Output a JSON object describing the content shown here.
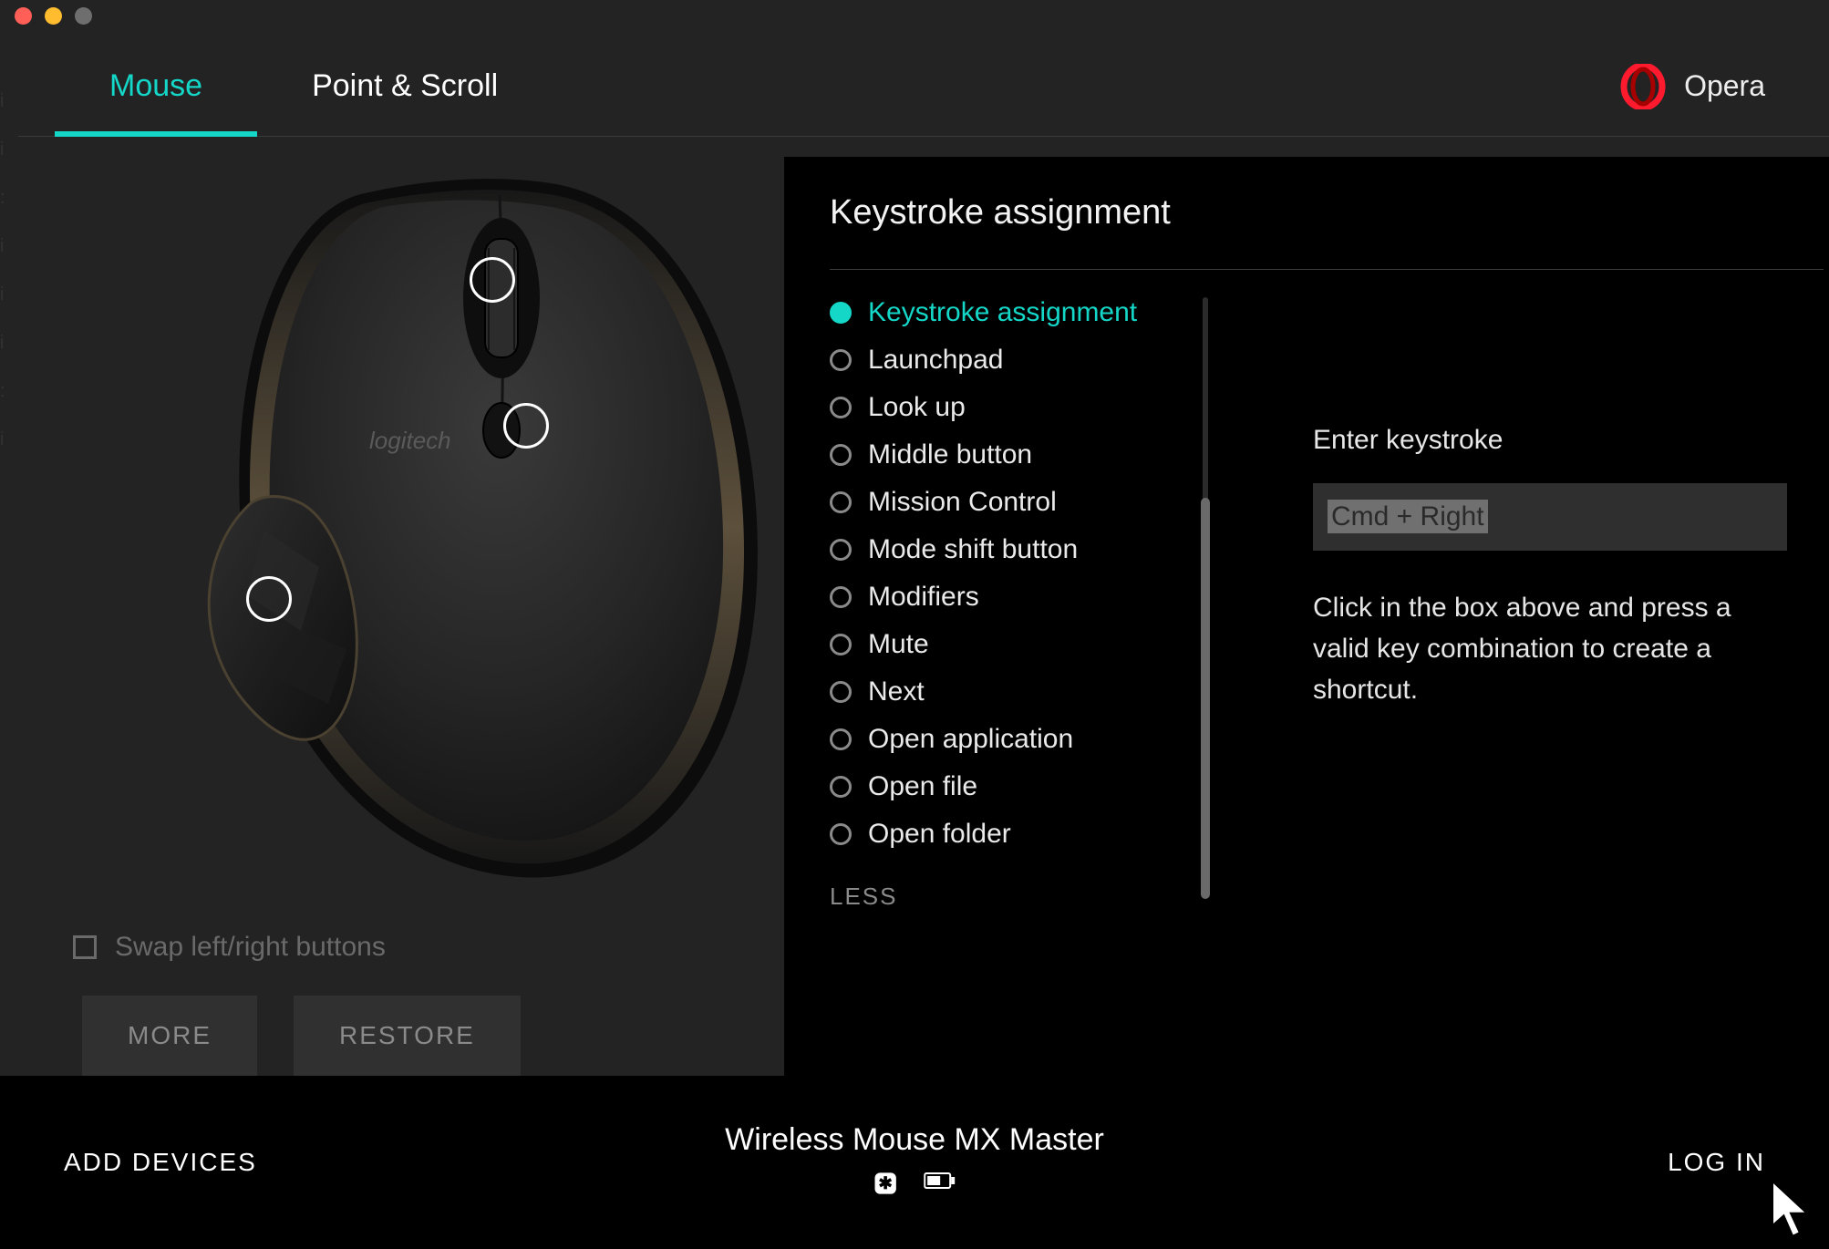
{
  "tabs": {
    "mouse": "Mouse",
    "point_scroll": "Point & Scroll"
  },
  "app_context": {
    "name": "Opera"
  },
  "mouse_image": {
    "brand": "logitech"
  },
  "swap_label": "Swap left/right buttons",
  "buttons": {
    "more": "MORE",
    "restore": "RESTORE"
  },
  "panel": {
    "title": "Keystroke assignment",
    "options": [
      "Keystroke assignment",
      "Launchpad",
      "Look up",
      "Middle button",
      "Mission Control",
      "Mode shift button",
      "Modifiers",
      "Mute",
      "Next",
      "Open application",
      "Open file",
      "Open folder"
    ],
    "selected_index": 0,
    "less": "LESS",
    "detail": {
      "label": "Enter keystroke",
      "value": "Cmd + Right",
      "help": "Click in the box above and press a valid key combination to create a shortcut."
    }
  },
  "bottom": {
    "add_devices": "ADD DEVICES",
    "device_name": "Wireless Mouse MX Master",
    "login": "LOG IN"
  },
  "colors": {
    "accent": "#14d7c8"
  }
}
